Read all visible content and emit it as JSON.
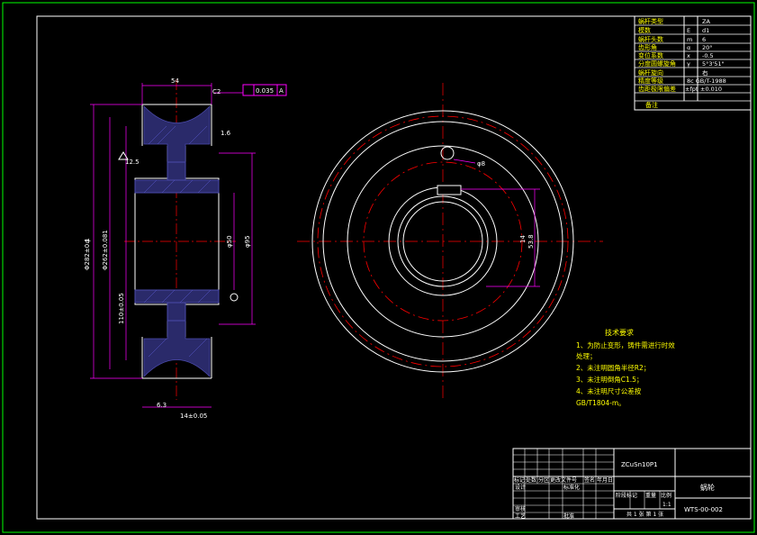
{
  "params_table": {
    "rows": [
      {
        "name": "蜗杆类型",
        "sym": "",
        "val": "ZA"
      },
      {
        "name": "模数",
        "sym": "E",
        "val": "d1"
      },
      {
        "name": "蜗杆头数",
        "sym": "m",
        "val": "6"
      },
      {
        "name": "齿形角",
        "sym": "α",
        "val": "20°"
      },
      {
        "name": "变位系数",
        "sym": "x",
        "val": "-0.5"
      },
      {
        "name": "分度圆螺旋角",
        "sym": "γ",
        "val": "5°3'51\""
      },
      {
        "name": "蜗杆旋向",
        "sym": "",
        "val": "右"
      },
      {
        "name": "精度等级",
        "sym": "",
        "val": "8c GB/T-1988"
      },
      {
        "name": "齿距极限偏差",
        "sym": "±fpt",
        "val": "±0.010"
      },
      {
        "name": "备注",
        "sym": "",
        "val": ""
      }
    ]
  },
  "dimensions": {
    "width_top": "54",
    "chamfer": "C2",
    "tolerance_value": "0.035",
    "datum": "A",
    "roughness_left": "12.5",
    "roughness_hub": "1.6",
    "dia_outer": "φ",
    "dia_1": "Φ282±0.1",
    "dia_2": "Φ262±0.081",
    "dia_3": "110±0.05",
    "bore": "φ50",
    "hub": "φ95",
    "bottom_width": "14±0.05",
    "roughness_bottom": "6.3",
    "hole": "φ8",
    "keyway_w": "14",
    "keyway_h": "53.8"
  },
  "tech_requirements": {
    "title": "技术要求",
    "lines": [
      "1、为防止变形，铸件需进行时效",
      "处理；",
      "2、未注明圆角半径R2；",
      "3、未注明倒角C1.5；",
      "4、未注明尺寸公差按",
      "GB/T1804-m。"
    ]
  },
  "title_block": {
    "material": "ZCuSn10P1",
    "part_name": "蜗轮",
    "drawing_no": "WTS-00-002",
    "scale": "1:1",
    "marks": [
      "标记",
      "处数",
      "分区",
      "更改文件号",
      "签名",
      "年月日"
    ],
    "roles": [
      "设计",
      "审核",
      "工艺"
    ],
    "std_label": "标准化",
    "approve_label": "批准",
    "stage_labels": [
      "阶段标记",
      "重量",
      "比例"
    ],
    "sheets": "共 1 张  第 1 张"
  }
}
